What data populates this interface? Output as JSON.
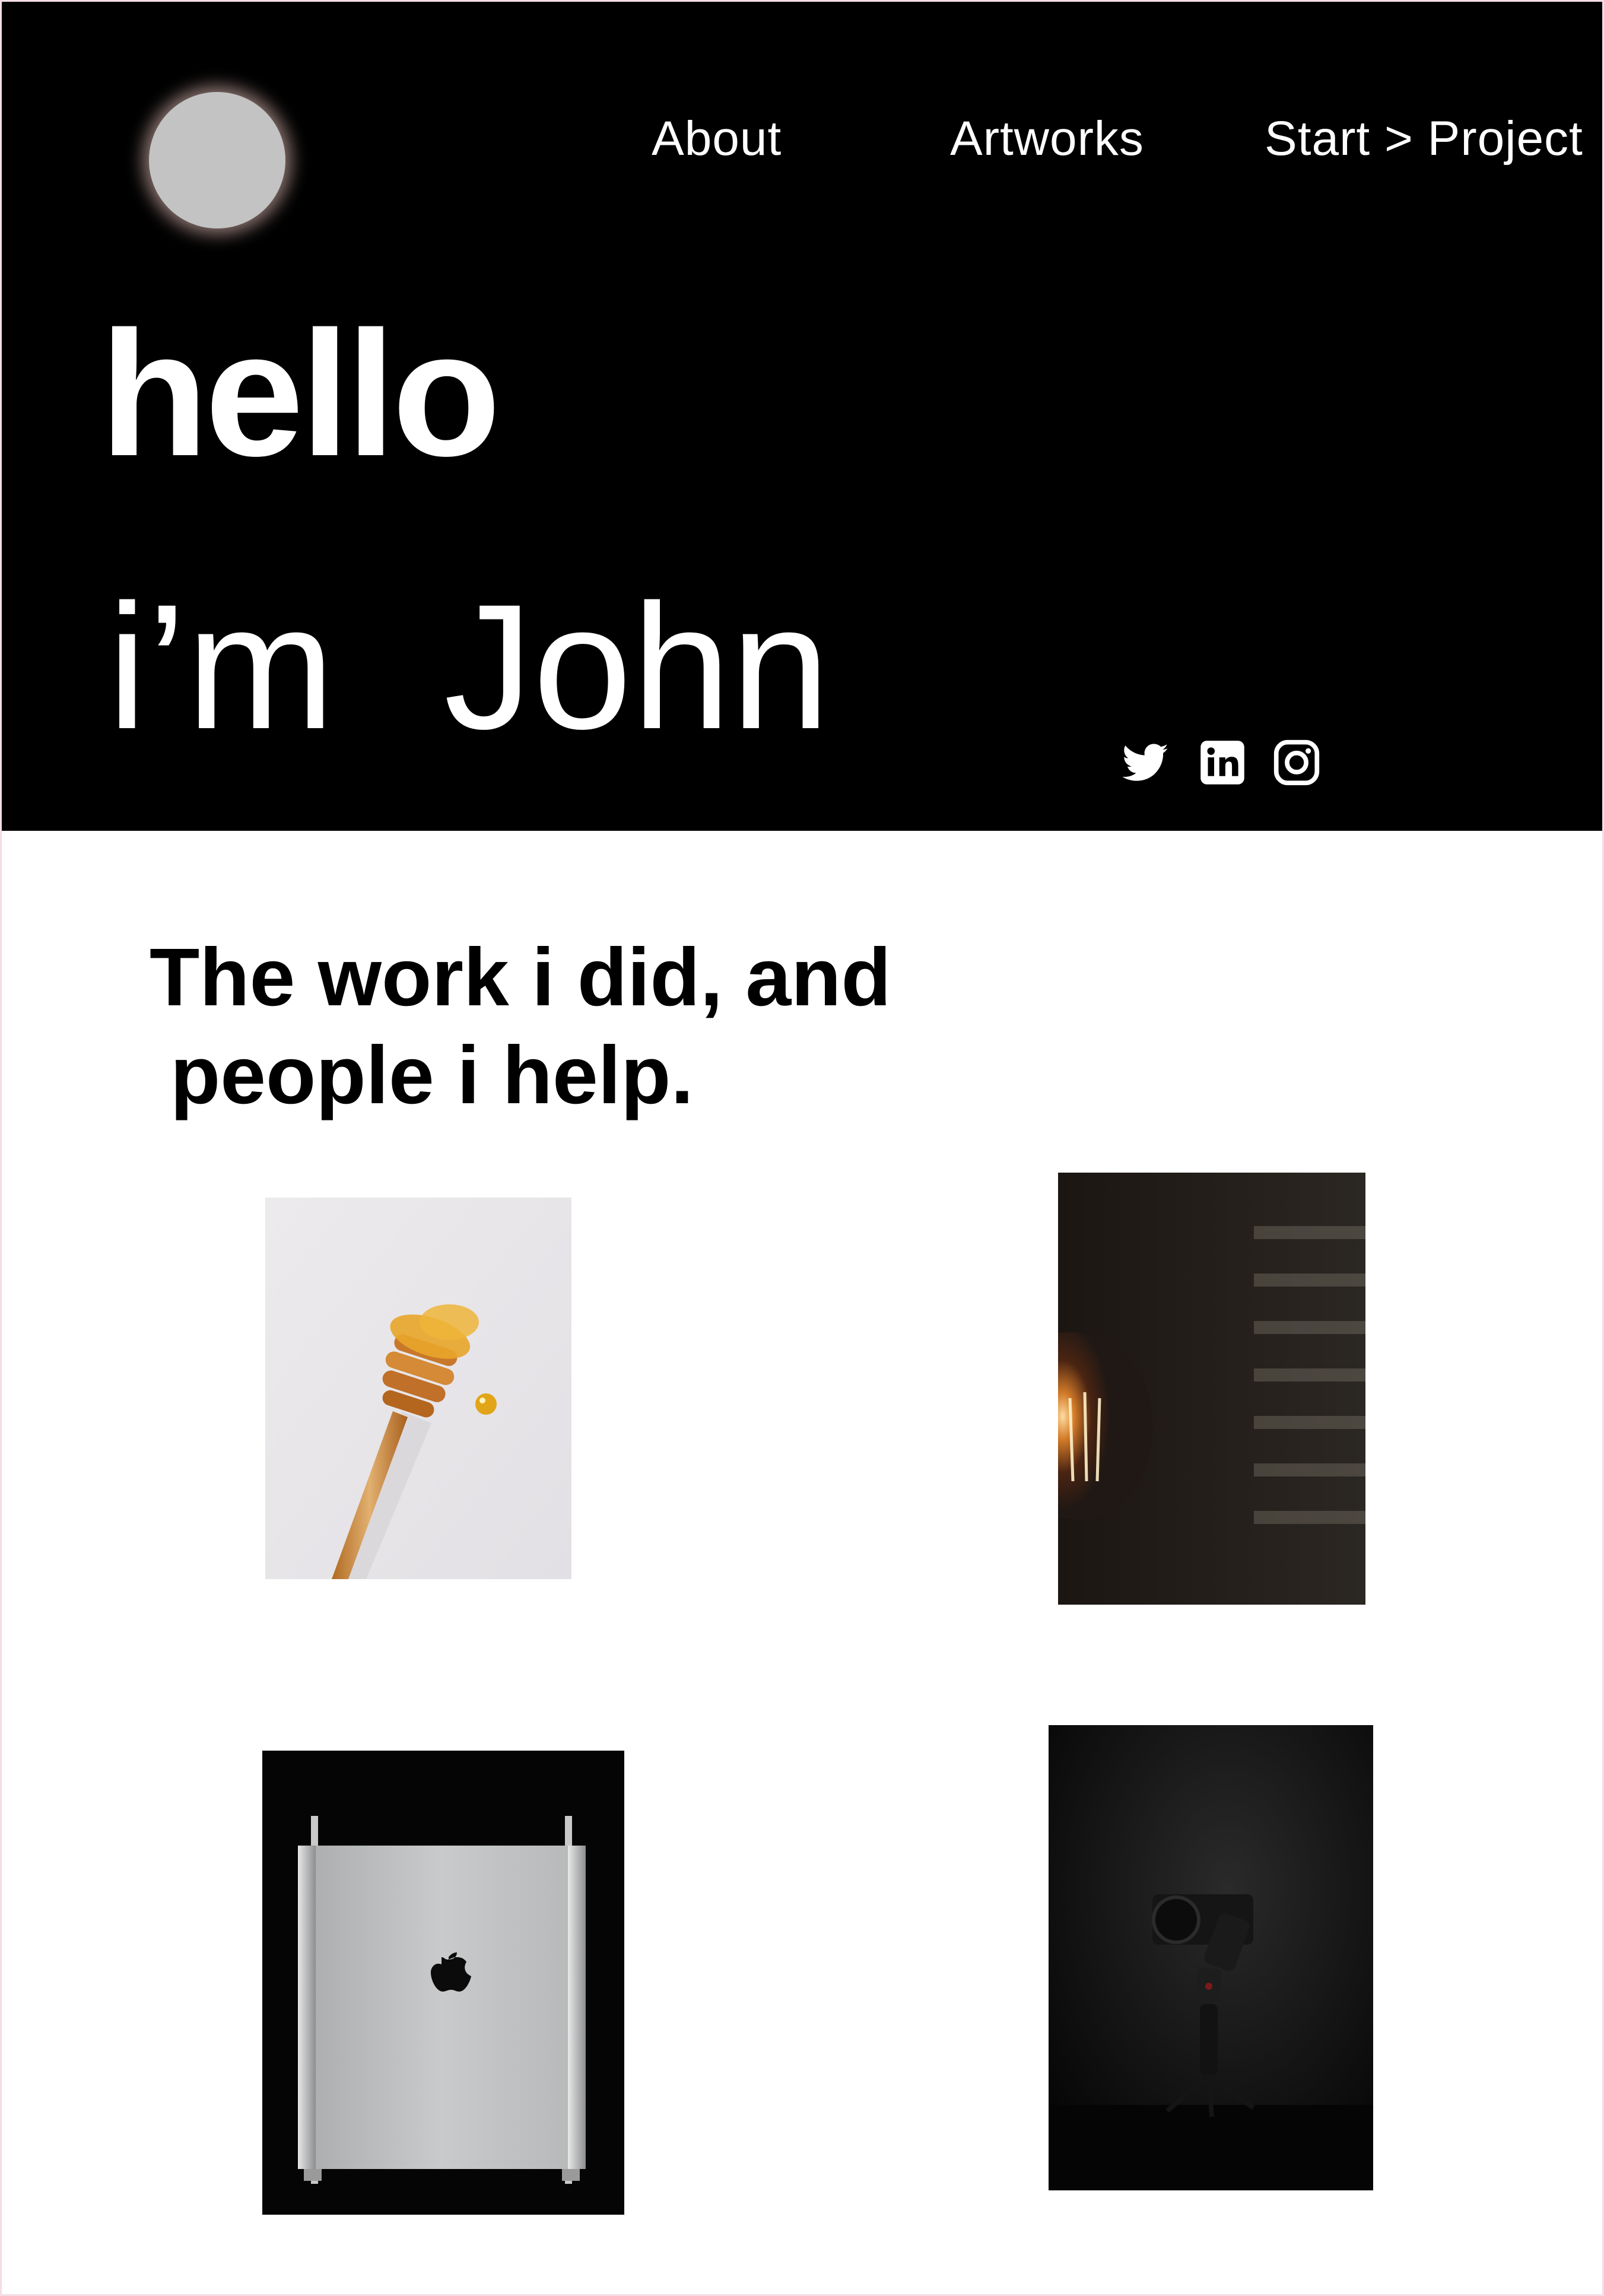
{
  "header": {
    "nav": {
      "about": "About",
      "artworks": "Artworks",
      "start_project": "Start > Project"
    },
    "greeting_line1": "hello",
    "greeting_im": "i’m",
    "greeting_name": "John",
    "social_icons": [
      "twitter-icon",
      "linkedin-icon",
      "instagram-icon"
    ]
  },
  "work": {
    "title_line1": "The work i did, and",
    "title_line2": "people i help.",
    "gallery": [
      "honey-dipper-photo",
      "light-bulb-photo",
      "mac-pro-photo",
      "camera-gimbal-photo"
    ]
  },
  "colors": {
    "hero_background": "#000000",
    "page_background": "#ffffff",
    "avatar": "#c3c3c3",
    "text_light": "#ffffff",
    "text_dark": "#000000"
  }
}
